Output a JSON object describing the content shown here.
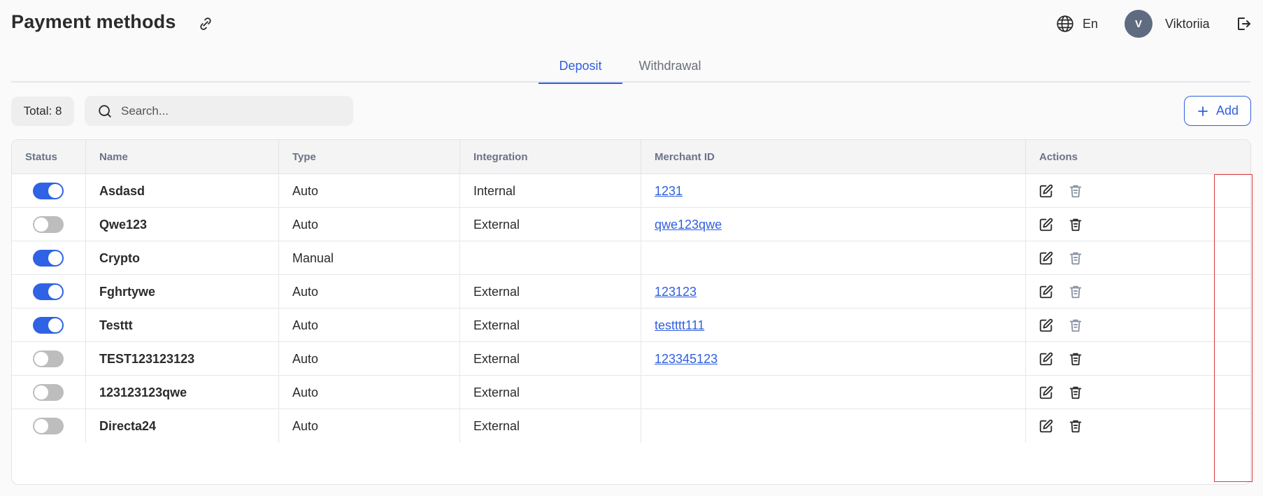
{
  "header": {
    "title": "Payment methods",
    "language": "En",
    "user": {
      "initial": "V",
      "name": "Viktoriia"
    }
  },
  "tabs": [
    {
      "label": "Deposit",
      "active": true
    },
    {
      "label": "Withdrawal",
      "active": false
    }
  ],
  "toolbar": {
    "total_label": "Total: 8",
    "search_placeholder": "Search...",
    "add_label": "Add"
  },
  "table": {
    "columns": [
      "Status",
      "Name",
      "Type",
      "Integration",
      "Merchant ID",
      "Actions"
    ],
    "rows": [
      {
        "status": true,
        "name": "Asdasd",
        "type": "Auto",
        "integration": "Internal",
        "merchant_id": "1231",
        "delete_enabled": false
      },
      {
        "status": false,
        "name": "Qwe123",
        "type": "Auto",
        "integration": "External",
        "merchant_id": "qwe123qwe",
        "delete_enabled": true
      },
      {
        "status": true,
        "name": "Crypto",
        "type": "Manual",
        "integration": "",
        "merchant_id": "",
        "delete_enabled": false
      },
      {
        "status": true,
        "name": "Fghrtywe",
        "type": "Auto",
        "integration": "External",
        "merchant_id": "123123",
        "delete_enabled": false
      },
      {
        "status": true,
        "name": "Testtt",
        "type": "Auto",
        "integration": "External",
        "merchant_id": "testttt111",
        "delete_enabled": false
      },
      {
        "status": false,
        "name": "TEST123123123",
        "type": "Auto",
        "integration": "External",
        "merchant_id": "123345123",
        "delete_enabled": true
      },
      {
        "status": false,
        "name": "123123123qwe",
        "type": "Auto",
        "integration": "External",
        "merchant_id": "",
        "delete_enabled": true
      },
      {
        "status": false,
        "name": "Directa24",
        "type": "Auto",
        "integration": "External",
        "merchant_id": "",
        "delete_enabled": true
      }
    ]
  },
  "colors": {
    "accent": "#2f5fe0",
    "toggle_on": "#2f62e4",
    "toggle_off": "#bdbdbd",
    "icon_active": "#2b2b2b",
    "icon_disabled": "#8a92a3",
    "highlight": "#e03a3a"
  },
  "icons": {
    "link": "link-icon",
    "globe": "globe-icon",
    "logout": "logout-icon",
    "search": "search-icon",
    "plus": "plus-icon",
    "edit": "edit-icon",
    "delete": "trash-icon"
  }
}
